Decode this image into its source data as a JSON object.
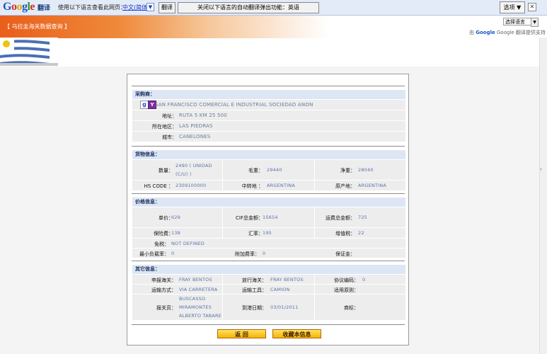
{
  "translate_bar": {
    "logo": [
      "G",
      "o",
      "o",
      "g",
      "l",
      "e"
    ],
    "name": "翻译",
    "prompt": "使用以下语言查看此网页：",
    "language": "中文(简体)",
    "dropdown_arrow": "▼",
    "translate_button": "翻译",
    "disable_button": "关闭以下语言的自动翻译弹出功能：英语",
    "options_button": "选项 ▼",
    "close_icon": "✕"
  },
  "site_header": {
    "title": "【 乌拉圭海关数据查询 】",
    "language_select": "选择语言",
    "language_select_arrow": "▼",
    "powered_prefix": "由",
    "powered_brand": "Google",
    "powered_suffix": "Google 翻译提供支持"
  },
  "buyer": {
    "header": "采购商：",
    "company": "SAN FRANCISCO COMERCIAL E INDUSTRIAL SOCIEDAD ANON",
    "address_label": "地址：",
    "address": "RUTA 5 KM 25 500",
    "region_label": "所在地区：",
    "region": "LAS PIEDRAS",
    "city_label": "城市：",
    "city": "CANELONES"
  },
  "goods": {
    "header": "货物信息：",
    "quantity_label": "数量：",
    "quantity_line1": "2490 ( UNIDAD",
    "quantity_line2": "(C/U) )",
    "gross_label": "毛重：",
    "gross": "29440",
    "net_label": "净重：",
    "net": "28040",
    "hs_label": "HS CODE ：",
    "hs": "2309100000",
    "transit_label": "中转地 ：",
    "transit": "ARGENTINA",
    "origin_label": "原产地：",
    "origin": "ARGENTINA"
  },
  "price": {
    "header": "价格信息：",
    "unit_label": "单价：",
    "unit": "629",
    "cif_label": "CIF总金额：",
    "cif": "15654",
    "freight_label": "运费总金额：",
    "freight": "725",
    "insurance_label": "保险费：",
    "insurance": "138",
    "rate_label": "汇率：",
    "rate": "195",
    "vat_label": "增值税：",
    "vat": "22",
    "exempt_label": "免税：",
    "exempt": "NOT DEFINED",
    "minrate_label": "最小负载率：",
    "minrate": "0",
    "surcharge_label": "附加费率：",
    "surcharge": "0",
    "deposit_label": "保证金："
  },
  "other": {
    "header": "其它信息：",
    "declare_customs_label": "申报海关：",
    "declare_customs": "FRAY BENTOS",
    "release_customs_label": "放行海关：",
    "release_customs": "FRAY BENTOS",
    "agreement_label": "协议编码：",
    "agreement": "0",
    "transport_mode_label": "运输方式：",
    "transport_mode": "VIA CARRETERA",
    "transport_tool_label": "运输工具：",
    "transport_tool": "CAMION",
    "rule_label": "适用原则：",
    "broker_label": "报关员：",
    "broker_lines": [
      "BUSCASSO",
      "MIRAMONTES",
      "ALBERTO TABARE"
    ],
    "arrival_label": "到港日期：",
    "arrival": "03/01/2011",
    "brand_label": "商标："
  },
  "buttons": {
    "back": "返 回",
    "favorite": "收藏本信息"
  },
  "colors": {
    "header_orange": "#e95e1a",
    "section_bg": "#dde6f5",
    "row_bg": "#ededed",
    "value_blue": "#5b74a8",
    "button_yellow": "#f5b400"
  },
  "icons": {
    "company_icons": [
      "google-search-icon",
      "yahoo-icon"
    ]
  }
}
